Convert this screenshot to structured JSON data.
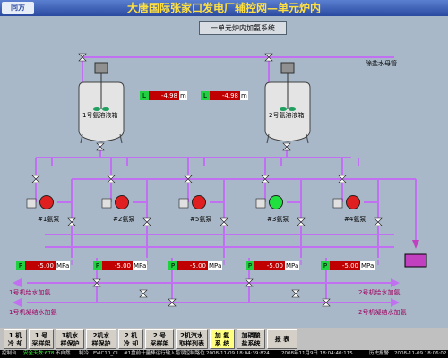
{
  "header": {
    "logo_text": "同方",
    "title": "大唐国际张家口发电厂辅控网—单元炉内"
  },
  "subtitle": "一单元炉内加氨系统",
  "tanks": [
    {
      "name": "1号氨溶液箱",
      "level_prefix": "L",
      "level_value": "-4.98",
      "level_unit": "m"
    },
    {
      "name": "2号氨溶液箱",
      "level_prefix": "L",
      "level_value": "-4.98",
      "level_unit": "m"
    }
  ],
  "labels": {
    "demin_pipe": "除盐水母管"
  },
  "pumps": [
    {
      "name": "#1氨泵",
      "state": "red"
    },
    {
      "name": "#2氨泵",
      "state": "red"
    },
    {
      "name": "#5氨泵",
      "state": "red"
    },
    {
      "name": "#3氨泵",
      "state": "green"
    },
    {
      "name": "#4氨泵",
      "state": "red"
    }
  ],
  "pressures": [
    {
      "prefix": "P",
      "value": "-5.00",
      "unit": "MPa"
    },
    {
      "prefix": "P",
      "value": "-5.00",
      "unit": "MPa"
    },
    {
      "prefix": "P",
      "value": "-5.00",
      "unit": "MPa"
    },
    {
      "prefix": "P",
      "value": "-5.00",
      "unit": "MPa"
    },
    {
      "prefix": "P",
      "value": "-5.00",
      "unit": "MPa"
    }
  ],
  "outlets": {
    "left_top": "1号机给水加氨",
    "left_bottom": "1号机凝结水加氨",
    "right_top": "2号机给水加氨",
    "right_bottom": "2号机凝结水加氨"
  },
  "nav": [
    {
      "l1": "1 机",
      "l2": "冷 却"
    },
    {
      "l1": "1 号",
      "l2": "采样架"
    },
    {
      "l1": "1机水",
      "l2": "样保护"
    },
    {
      "l1": "2机水",
      "l2": "样保护"
    },
    {
      "l1": "2 机",
      "l2": "冷 却"
    },
    {
      "l1": "2 号",
      "l2": "采样架"
    },
    {
      "l1": "2机汽水",
      "l2": "取样列表"
    },
    {
      "l1": "加 氨",
      "l2": "系 统"
    },
    {
      "l1": "加磷酸",
      "l2": "盐系统"
    },
    {
      "l1": "报 表",
      "l2": ""
    }
  ],
  "status": {
    "s1": "控制台",
    "s2": "安全天数:678",
    "s3": "不自然",
    "s4": "制冷",
    "s5": "FVIC10_CL",
    "s6": "#1盘前计量棒运行输入错误控制路位",
    "s7": "2008-11-09 18:04:39:824",
    "s8": "2008年11月9日 18:04:40:115",
    "s9": "历史报警",
    "s10": "2008-11-09 18:06:02"
  },
  "colors": {
    "pipe": "#c070f0",
    "tank_fill": "#e8e8e8",
    "valve": "#ffffff"
  }
}
